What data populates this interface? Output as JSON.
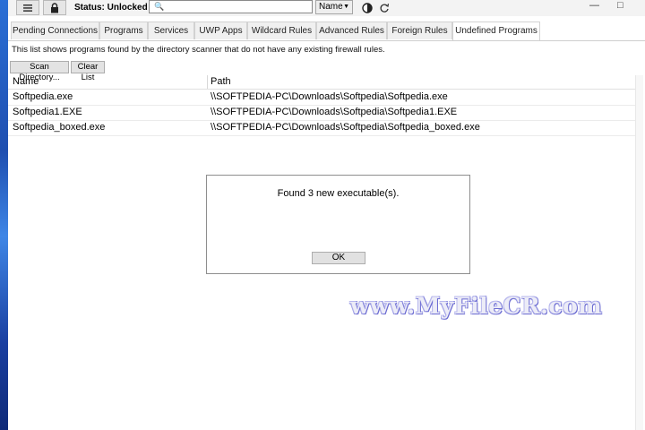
{
  "toolbar": {
    "menu_icon": "hamburger-icon",
    "lock_icon": "lock-icon",
    "status_text": "Status: Unlocked",
    "search_value": "",
    "search_placeholder": "",
    "sort_value": "Name",
    "refresh_icon": "refresh-icon"
  },
  "tabs": [
    {
      "label": "Pending Connections"
    },
    {
      "label": "Programs"
    },
    {
      "label": "Services"
    },
    {
      "label": "UWP Apps"
    },
    {
      "label": "Wildcard Rules"
    },
    {
      "label": "Advanced Rules"
    },
    {
      "label": "Foreign Rules"
    },
    {
      "label": "Undefined Programs"
    }
  ],
  "active_tab": "Undefined Programs",
  "description": "This list shows programs found by the directory scanner that do not have any existing firewall rules.",
  "buttons": {
    "scan": "Scan Directory...",
    "clear": "Clear List"
  },
  "list": {
    "columns": [
      "Name",
      "Path"
    ],
    "rows": [
      {
        "name": "Softpedia.exe",
        "path": "\\\\SOFTPEDIA-PC\\Downloads\\Softpedia\\Softpedia.exe"
      },
      {
        "name": "Softpedia1.EXE",
        "path": "\\\\SOFTPEDIA-PC\\Downloads\\Softpedia\\Softpedia1.EXE"
      },
      {
        "name": "Softpedia_boxed.exe",
        "path": "\\\\SOFTPEDIA-PC\\Downloads\\Softpedia\\Softpedia_boxed.exe"
      }
    ]
  },
  "dialog": {
    "message": "Found 3 new executable(s).",
    "ok_label": "OK"
  },
  "watermark": "www.MyFileCR.com"
}
